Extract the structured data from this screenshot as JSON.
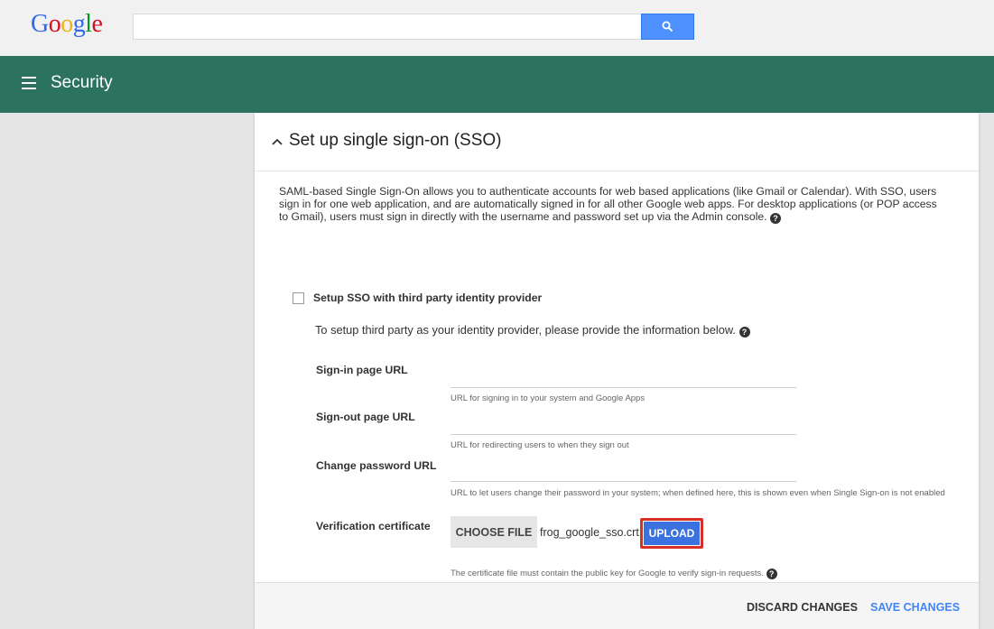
{
  "logo": {
    "letters": [
      "G",
      "o",
      "o",
      "g",
      "l",
      "e"
    ],
    "colors": [
      "#3369e8",
      "#d50f25",
      "#eeb211",
      "#3369e8",
      "#009925",
      "#d50f25"
    ]
  },
  "search": {
    "value": "",
    "placeholder": ""
  },
  "header": {
    "title": "Security",
    "background": "#2b735f"
  },
  "card": {
    "title": "Set up single sign-on (SSO)",
    "description": "SAML-based Single Sign-On allows you to authenticate accounts for web based applications (like Gmail or Calendar). With SSO, users sign in for one web application, and are automatically signed in for all other Google web apps. For desktop applications (or POP access to Gmail), users must sign in directly with the username and password set up via the Admin console.",
    "checkbox_label": "Setup SSO with third party identity provider",
    "checkbox_checked": false,
    "intro": "To setup third party as your identity provider, please provide the information below.",
    "fields": [
      {
        "label": "Sign-in page URL",
        "value": "",
        "hint": "URL for signing in to your system and Google Apps"
      },
      {
        "label": "Sign-out page URL",
        "value": "",
        "hint": "URL for redirecting users to when they sign out"
      },
      {
        "label": "Change password URL",
        "value": "",
        "hint": "URL to let users change their password in your system; when defined here, this is shown even when Single Sign-on is not enabled"
      }
    ],
    "certificate": {
      "label": "Verification certificate",
      "choose_label": "CHOOSE FILE",
      "filename": "frog_google_sso.crt",
      "upload_label": "UPLOAD",
      "hint": "The certificate file must contain the public key for Google to verify sign-in requests."
    },
    "footer": {
      "discard_label": "DISCARD CHANGES",
      "save_label": "SAVE CHANGES"
    }
  },
  "icons": {
    "search": "search-icon",
    "menu": "hamburger-menu-icon",
    "collapse": "chevron-up-icon",
    "help": "help-icon"
  },
  "colors": {
    "accent": "#4285f4",
    "upload": "#3c72e0",
    "highlight": "#d93025"
  }
}
